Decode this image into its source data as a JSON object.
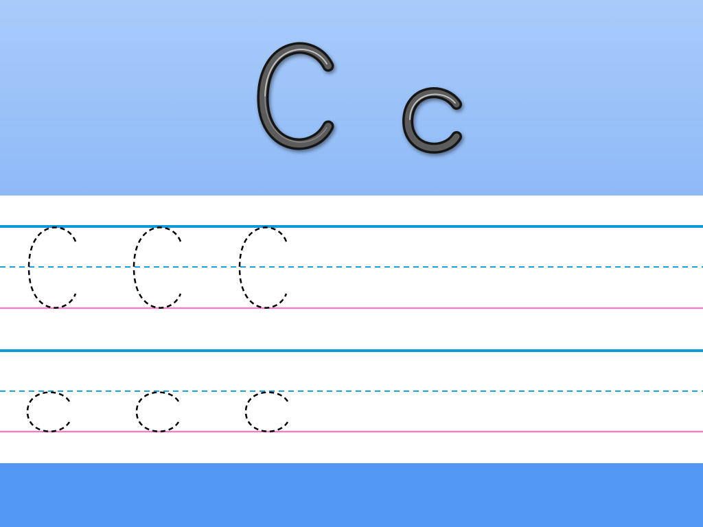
{
  "title": {
    "uppercase_letter": "C",
    "lowercase_letter": "c"
  },
  "practice": {
    "uppercase_row": {
      "letter": "C",
      "trace_count": 3
    },
    "lowercase_row": {
      "letter": "c",
      "trace_count": 3
    }
  },
  "colors": {
    "header_top": "#a9cbfa",
    "header_bottom": "#8fbaf7",
    "footer": "#5298f2",
    "top_line": "#0e9ad8",
    "mid_dashed_line": "#1aa1dd",
    "base_line": "#e783c4",
    "trace_stroke": "#000000",
    "letter_fill": "#2b2b2b"
  }
}
